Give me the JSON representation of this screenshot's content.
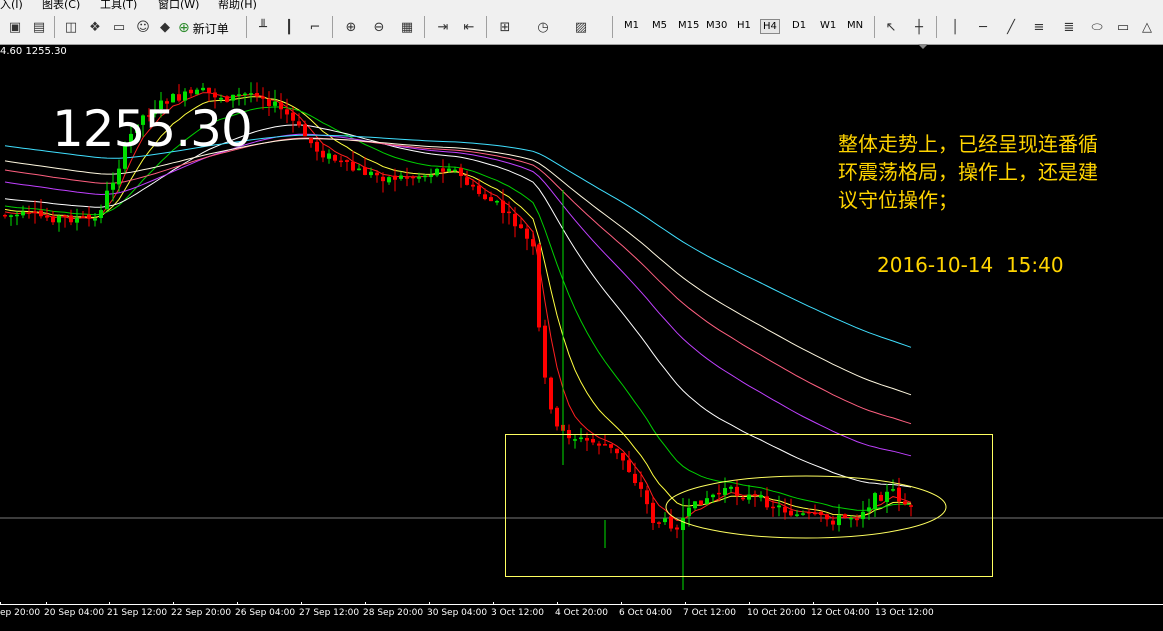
{
  "menu": {
    "items": [
      "入(I)",
      "图表(C)",
      "工具(T)",
      "窗口(W)",
      "帮助(H)"
    ]
  },
  "toolbar": {
    "new_order_label": "新订单",
    "timeframes": [
      "M1",
      "M5",
      "M15",
      "M30",
      "H1",
      "H4",
      "D1",
      "W1",
      "MN"
    ],
    "active_timeframe": "H4"
  },
  "chart": {
    "header": "4.60 1255.30",
    "current_price": "1255.30",
    "annotation_lines": [
      "整体走势上，已经呈现连番循",
      "环震荡格局，操作上，还是建",
      "议守位操作；"
    ],
    "timestamp": "2016-10-14  15:40",
    "annotation_color": "#ffd400",
    "bull_color": "#00e000",
    "bear_color": "#ff0000",
    "ma_colors": [
      "#ff2020",
      "#ffff40",
      "#00d000",
      "#ffffff",
      "#c040ff",
      "#ff6080",
      "#fff8e0",
      "#40e0ff"
    ]
  },
  "xaxis": {
    "labels": [
      "ep 20:00",
      "20 Sep 04:00",
      "21 Sep 12:00",
      "22 Sep 20:00",
      "26 Sep 04:00",
      "27 Sep 12:00",
      "28 Sep 20:00",
      "30 Sep 04:00",
      "3 Oct 12:00",
      "4 Oct 20:00",
      "6 Oct 04:00",
      "7 Oct 12:00",
      "10 Oct 20:00",
      "12 Oct 04:00",
      "13 Oct 12:00"
    ]
  },
  "chart_data": {
    "type": "candlestick",
    "symbol_price": 1255.3,
    "x_labels": [
      "ep 20:00",
      "20 Sep 04:00",
      "21 Sep 12:00",
      "22 Sep 20:00",
      "26 Sep 04:00",
      "27 Sep 12:00",
      "28 Sep 20:00",
      "30 Sep 04:00",
      "3 Oct 12:00",
      "4 Oct 20:00",
      "6 Oct 04:00",
      "7 Oct 12:00",
      "10 Oct 20:00",
      "12 Oct 04:00",
      "13 Oct 12:00"
    ],
    "trend_description": "range then sharp decline then sideways consolidation"
  }
}
